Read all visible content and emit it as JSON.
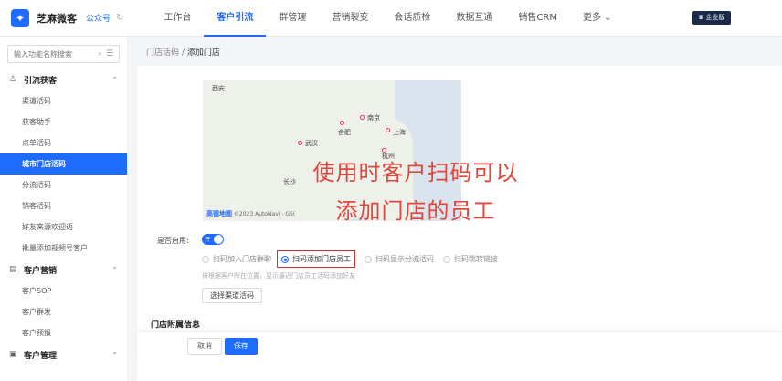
{
  "topbar": {
    "brand": "芝麻微客",
    "account_type": "公众号",
    "nav": [
      "工作台",
      "客户引流",
      "群管理",
      "营销裂变",
      "会话质检",
      "数据互通",
      "销售CRM",
      "更多 ⌄"
    ],
    "active_nav_index": 1,
    "edition": "企业版"
  },
  "sidebar": {
    "search_placeholder": "输入功能名称搜索",
    "groups": [
      {
        "label": "引流获客",
        "items": [
          "渠道活码",
          "获客助手",
          "点单活码",
          "城市门店活码",
          "分流活码",
          "销客活码",
          "好友来源欢迎语",
          "批量添加视频号客户"
        ]
      },
      {
        "label": "客户营销",
        "items": [
          "客户SOP",
          "客户群发",
          "客户预报"
        ]
      },
      {
        "label": "客户管理",
        "items": []
      }
    ],
    "active_item": "城市门店活码"
  },
  "breadcrumb": {
    "parent": "门店活码",
    "sep": "/",
    "current": "添加门店"
  },
  "map": {
    "cities": [
      "西安",
      "南京",
      "合肥",
      "上海",
      "武汉",
      "杭州",
      "长沙"
    ],
    "credit": "©2023 AutoNavi - GS(",
    "logo": "高德地图"
  },
  "overlay": {
    "line1": "使用时客户扫码可以",
    "line2": "添加门店的员工"
  },
  "form": {
    "enable_label": "是否启用:",
    "toggle_text": "开",
    "options": [
      "扫码加入门店群聊",
      "扫码添加门店员工",
      "扫码显示分流活码",
      "扫码跳转链接"
    ],
    "selected_index": 1,
    "hint": "将根据客户所在位置，显示最近门店员工活码添加好友",
    "select_channel": "选择渠道活码",
    "section_title": "门店附属信息"
  },
  "footer": {
    "cancel": "取消",
    "save": "保存"
  }
}
